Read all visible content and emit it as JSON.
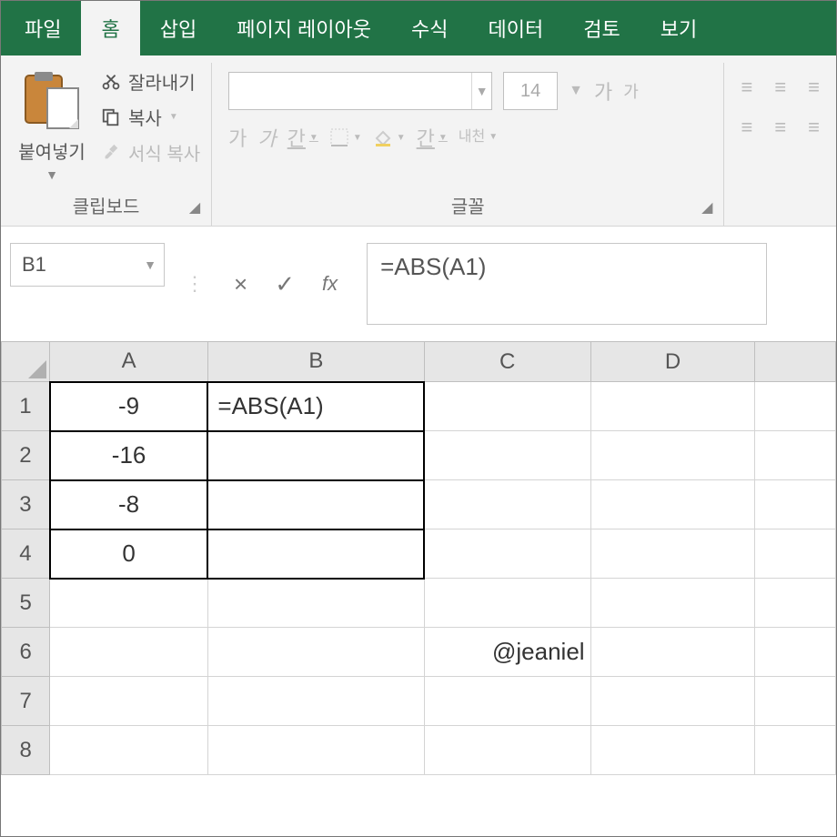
{
  "tabs": {
    "file": "파일",
    "home": "홈",
    "insert": "삽입",
    "layout": "페이지 레이아웃",
    "formula": "수식",
    "data": "데이터",
    "review": "검토",
    "view": "보기"
  },
  "ribbon": {
    "clipboard": {
      "paste": "붙여넣기",
      "cut": "잘라내기",
      "copy": "복사",
      "format_painter": "서식 복사",
      "label": "클립보드"
    },
    "font": {
      "size": "14",
      "grow_hint": "가",
      "shrink_hint": "가",
      "bold": "가",
      "italic": "가",
      "underline": "간",
      "underline2": "간",
      "ruby": "내천",
      "label": "글꼴"
    },
    "align": {
      "label": ""
    }
  },
  "formula_bar": {
    "cell_ref": "B1",
    "cancel": "×",
    "enter": "✓",
    "fx": "fx",
    "formula": "=ABS(A1)"
  },
  "sheet": {
    "columns": [
      "A",
      "B",
      "C",
      "D",
      ""
    ],
    "rows": [
      "1",
      "2",
      "3",
      "4",
      "5",
      "6",
      "7",
      "8"
    ],
    "cells": {
      "A1": "-9",
      "A2": "-16",
      "A3": "-8",
      "A4": "0",
      "B1": "=ABS(A1)"
    },
    "watermark": "@jeaniel"
  },
  "chart_data": {
    "type": "table",
    "columns": [
      "A",
      "B"
    ],
    "rows": [
      [
        "-9",
        "=ABS(A1)"
      ],
      [
        "-16",
        ""
      ],
      [
        "-8",
        ""
      ],
      [
        "0",
        ""
      ]
    ],
    "title": "",
    "formula_bar": "=ABS(A1)",
    "active_cell": "B1"
  }
}
